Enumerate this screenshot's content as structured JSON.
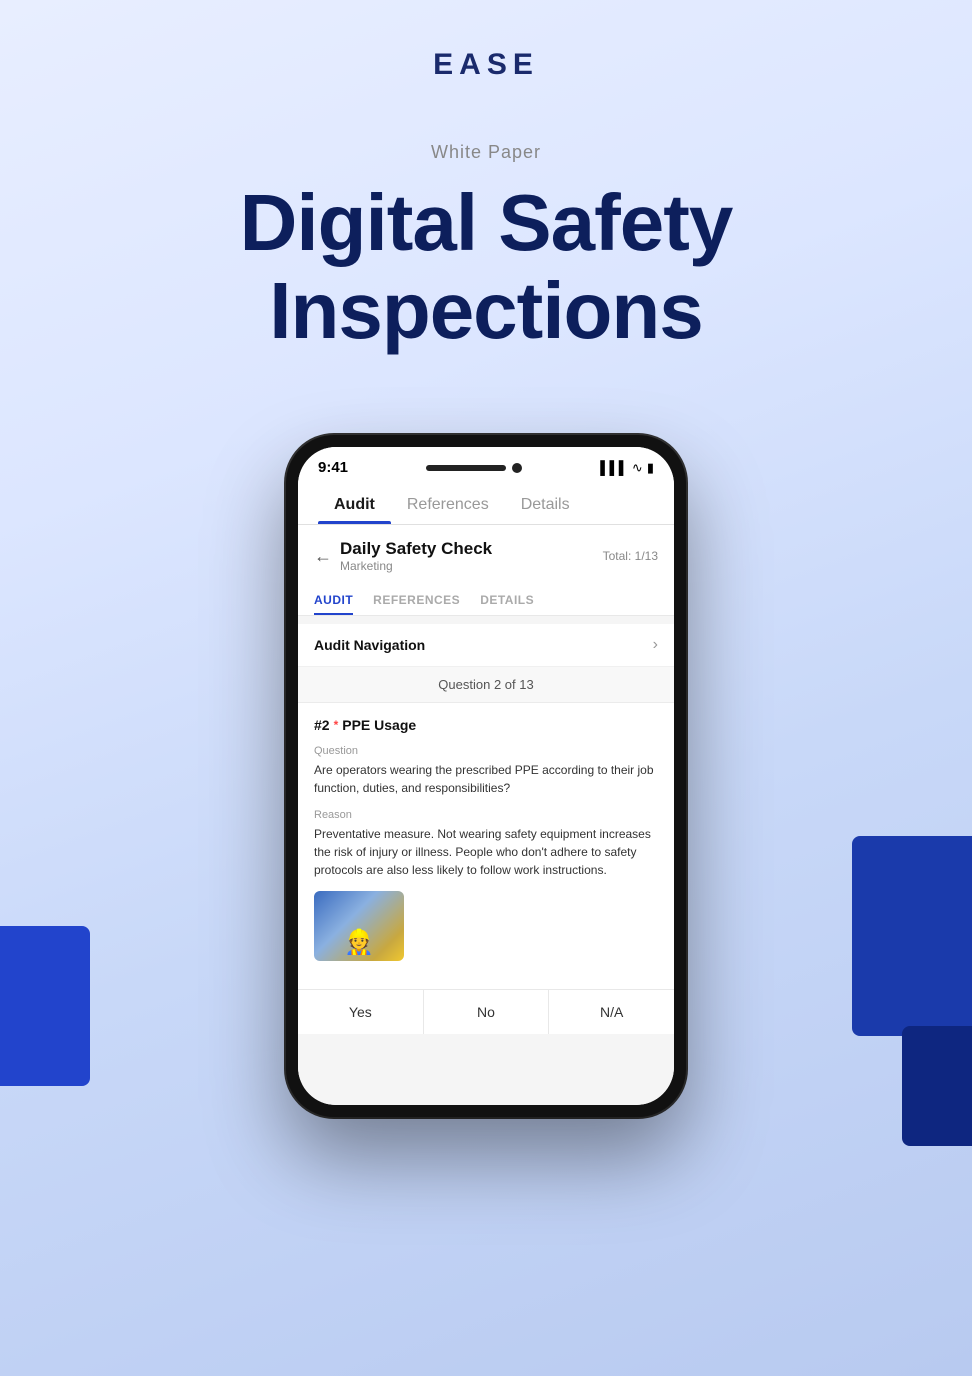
{
  "page": {
    "background": "#e8eeff"
  },
  "header": {
    "logo": "EASE",
    "white_paper_label": "White Paper",
    "main_title_line1": "Digital Safety",
    "main_title_line2": "Inspections"
  },
  "phone": {
    "status_bar": {
      "time": "9:41",
      "signal": "▌▌▌",
      "wifi": "WiFi",
      "battery": "▮"
    },
    "outer_tabs": [
      {
        "label": "Audit",
        "active": true
      },
      {
        "label": "References",
        "active": false
      },
      {
        "label": "Details",
        "active": false
      }
    ],
    "app_header": {
      "back_arrow": "←",
      "title": "Daily Safety Check",
      "subtitle": "Marketing",
      "total": "Total: 1/13"
    },
    "inner_tabs": [
      {
        "label": "AUDIT",
        "active": true
      },
      {
        "label": "REFERENCES",
        "active": false
      },
      {
        "label": "DETAILS",
        "active": false
      }
    ],
    "audit_navigation": {
      "label": "Audit Navigation",
      "chevron": "›"
    },
    "question_row": {
      "text": "Question 2 of 13"
    },
    "question": {
      "number": "#2",
      "required_star": "*",
      "title": "PPE Usage",
      "question_label": "Question",
      "question_text": "Are operators wearing the prescribed PPE according to their job function, duties, and responsibilities?",
      "reason_label": "Reason",
      "reason_text": "Preventative measure. Not wearing safety equipment increases the risk of injury or illness. People who don't adhere to safety protocols are also less likely to follow work instructions."
    },
    "action_buttons": [
      {
        "label": "Yes"
      },
      {
        "label": "No"
      },
      {
        "label": "N/A"
      }
    ]
  }
}
